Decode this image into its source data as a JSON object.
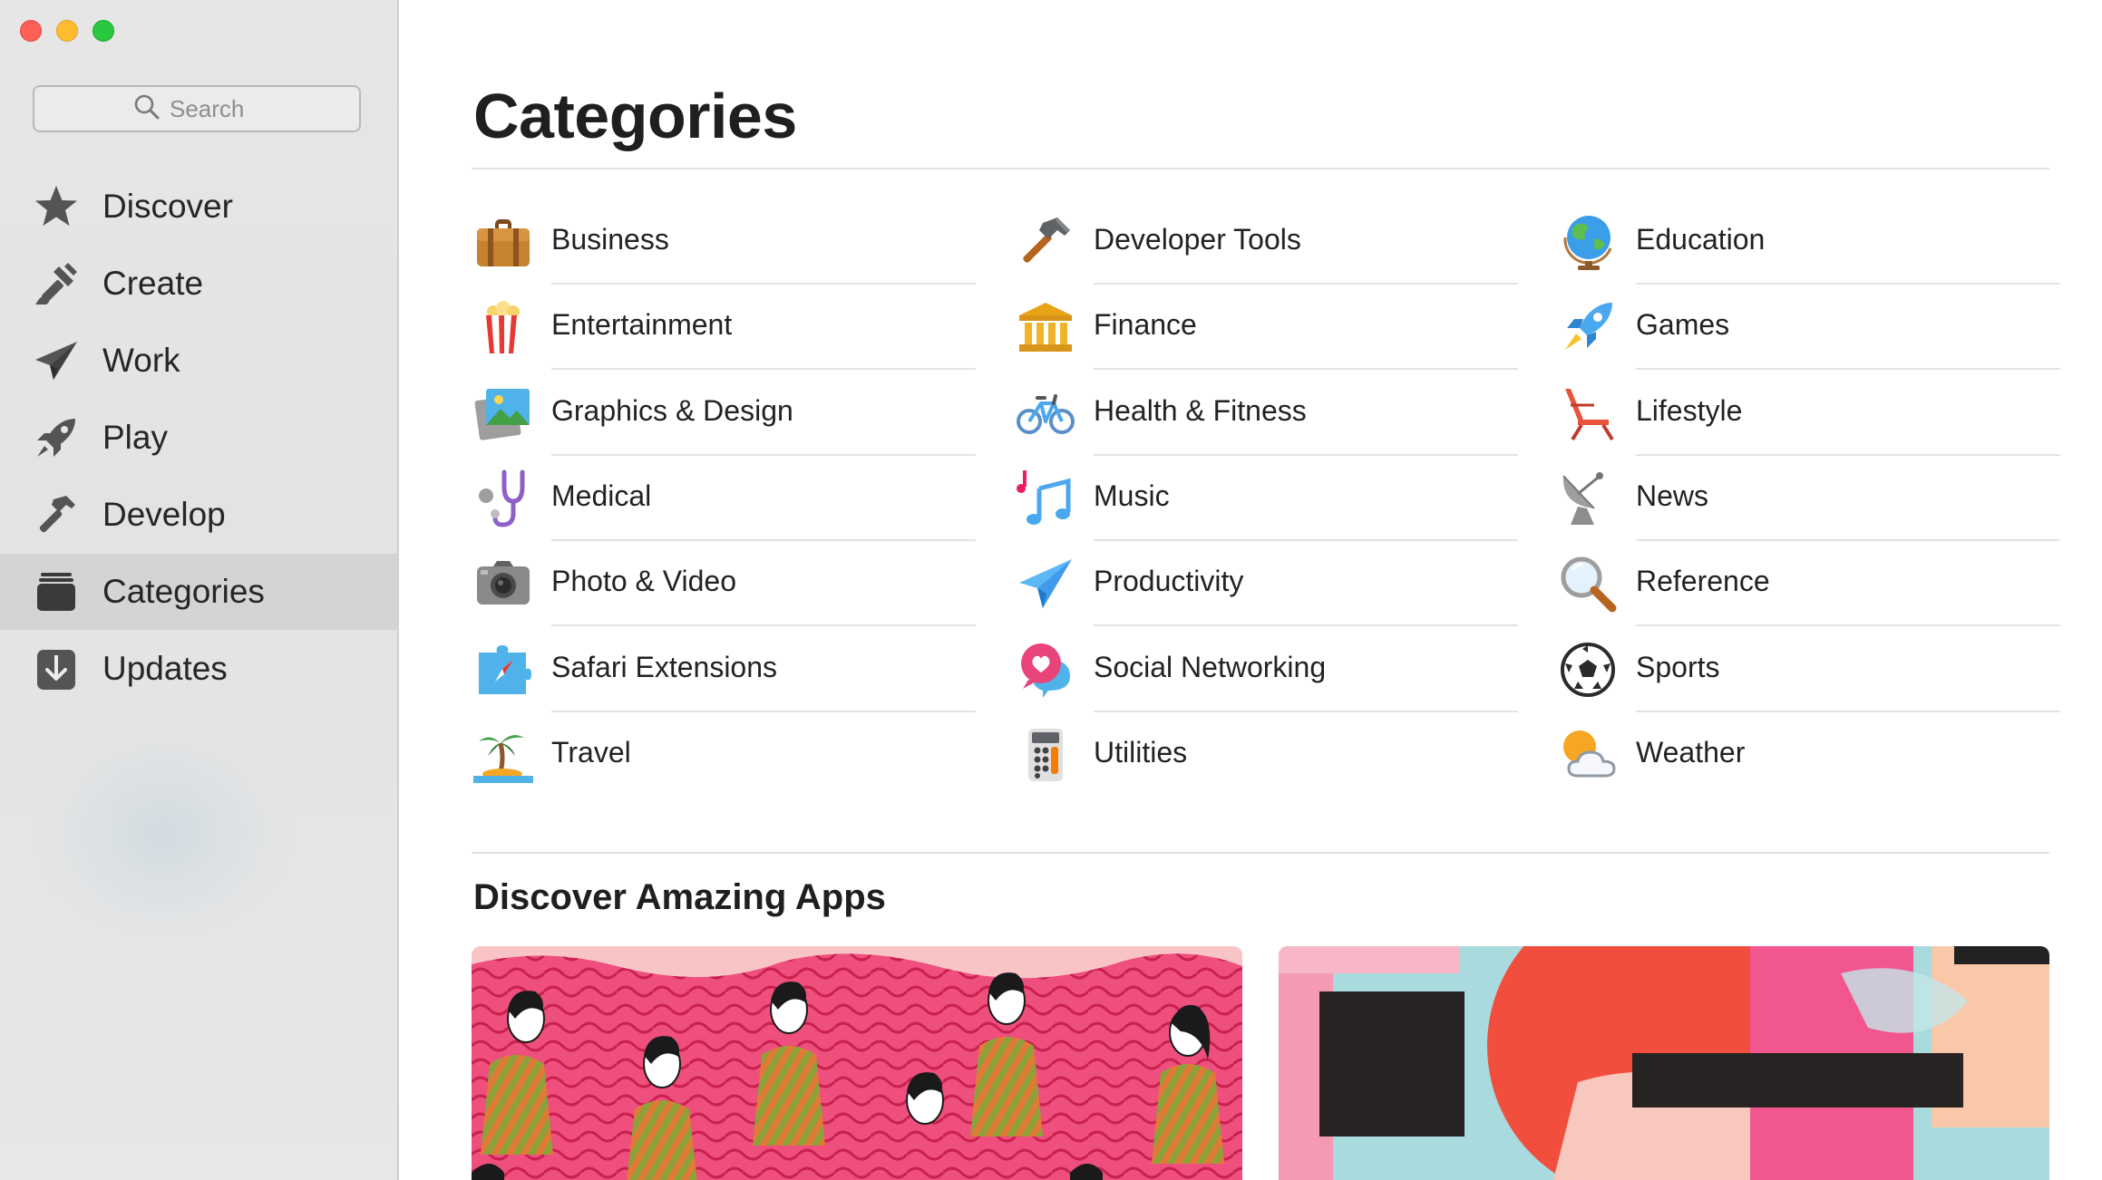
{
  "window": {
    "controls": [
      "close",
      "minimize",
      "zoom"
    ]
  },
  "sidebar": {
    "search": {
      "placeholder": "Search",
      "value": ""
    },
    "items": [
      {
        "label": "Discover",
        "icon": "star-icon",
        "selected": false
      },
      {
        "label": "Create",
        "icon": "paintbrush-icon",
        "selected": false
      },
      {
        "label": "Work",
        "icon": "paper-plane-icon",
        "selected": false
      },
      {
        "label": "Play",
        "icon": "rocket-icon",
        "selected": false
      },
      {
        "label": "Develop",
        "icon": "hammer-icon",
        "selected": false
      },
      {
        "label": "Categories",
        "icon": "stack-icon",
        "selected": true
      },
      {
        "label": "Updates",
        "icon": "download-icon",
        "selected": false
      }
    ]
  },
  "main": {
    "title": "Categories",
    "categories": [
      {
        "label": "Business",
        "icon": "briefcase-icon"
      },
      {
        "label": "Developer Tools",
        "icon": "hammer-icon"
      },
      {
        "label": "Education",
        "icon": "globe-icon"
      },
      {
        "label": "Entertainment",
        "icon": "popcorn-icon"
      },
      {
        "label": "Finance",
        "icon": "bank-icon"
      },
      {
        "label": "Games",
        "icon": "rocket-icon"
      },
      {
        "label": "Graphics & Design",
        "icon": "pictures-icon"
      },
      {
        "label": "Health & Fitness",
        "icon": "bicycle-icon"
      },
      {
        "label": "Lifestyle",
        "icon": "beach-chair-icon"
      },
      {
        "label": "Medical",
        "icon": "stethoscope-icon"
      },
      {
        "label": "Music",
        "icon": "music-notes-icon"
      },
      {
        "label": "News",
        "icon": "satellite-dish-icon"
      },
      {
        "label": "Photo & Video",
        "icon": "camera-icon"
      },
      {
        "label": "Productivity",
        "icon": "paper-plane-icon"
      },
      {
        "label": "Reference",
        "icon": "magnifier-icon"
      },
      {
        "label": "Safari Extensions",
        "icon": "puzzle-compass-icon"
      },
      {
        "label": "Social Networking",
        "icon": "chat-heart-icon"
      },
      {
        "label": "Sports",
        "icon": "soccer-ball-icon"
      },
      {
        "label": "Travel",
        "icon": "palm-island-icon"
      },
      {
        "label": "Utilities",
        "icon": "calculator-icon"
      },
      {
        "label": "Weather",
        "icon": "sun-cloud-icon"
      }
    ],
    "discover_heading": "Discover Amazing Apps",
    "cards": [
      {
        "name": "people-illustration-card"
      },
      {
        "name": "abstract-shapes-card"
      }
    ]
  },
  "colors": {
    "sidebar_bg": "#e5e5e5",
    "selected_bg": "#d4d4d4",
    "accent_blue": "#3d9be9",
    "traffic_red": "#ff5f57",
    "traffic_yellow": "#febc2e",
    "traffic_green": "#28c840"
  }
}
